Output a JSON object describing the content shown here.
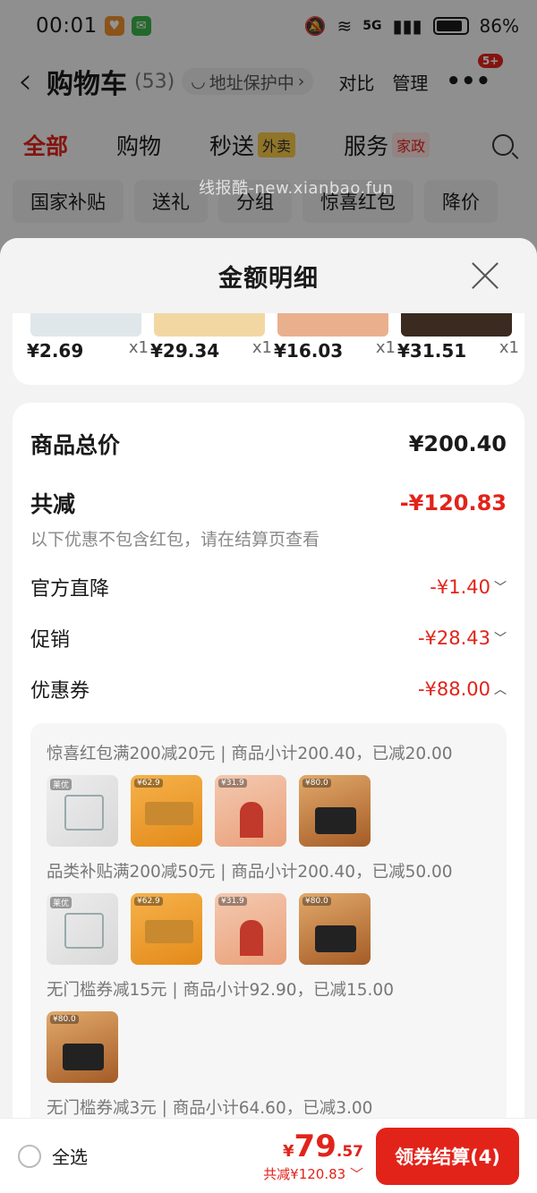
{
  "status_bar": {
    "time": "00:01",
    "network": "5G",
    "battery": "86%"
  },
  "cart_header": {
    "back_icon": "chevron-left-icon",
    "title": "购物车",
    "count": "(53)",
    "address_pill": "地址保护中",
    "compare": "对比",
    "manage": "管理",
    "more_badge": "5+"
  },
  "category_tabs": [
    {
      "label": "全部",
      "tag": ""
    },
    {
      "label": "购物",
      "tag": ""
    },
    {
      "label": "秒送",
      "tag": "外卖"
    },
    {
      "label": "服务",
      "tag": "家政"
    }
  ],
  "filter_chips": [
    "国家补贴",
    "送礼",
    "分组",
    "惊喜红包",
    "降价"
  ],
  "watermark": "线报酷-new.xianbao.fun",
  "sheet": {
    "title": "金额明细",
    "products": [
      {
        "price": "¥2.69",
        "qty": "x1",
        "color": "#dfe7ea"
      },
      {
        "price": "¥29.34",
        "qty": "x1",
        "color": "#f3d7a3"
      },
      {
        "price": "¥16.03",
        "qty": "x1",
        "color": "#e9b08e"
      },
      {
        "price": "¥31.51",
        "qty": "x1",
        "color": "#3a2a20"
      }
    ],
    "total_label": "商品总价",
    "total_value": "¥200.40",
    "reduce_label": "共减",
    "reduce_value": "-¥120.83",
    "note": "以下优惠不包含红包，请在结算页查看",
    "lines": [
      {
        "label": "官方直降",
        "value": "-¥1.40",
        "chevron": "chevron-down-icon"
      },
      {
        "label": "促销",
        "value": "-¥28.43",
        "chevron": "chevron-down-icon"
      },
      {
        "label": "优惠券",
        "value": "-¥88.00",
        "chevron": "chevron-up-icon"
      }
    ],
    "coupons": [
      {
        "text": "惊喜红包满200减20元 | 商品小计200.40，已减20.00",
        "thumbs": [
          "hooks",
          "tray",
          "chef",
          "bread"
        ]
      },
      {
        "text": "品类补贴满200减50元 | 商品小计200.40，已减50.00",
        "thumbs": [
          "hooks",
          "tray",
          "chef",
          "bread"
        ]
      },
      {
        "text": "无门槛券减15元 | 商品小计92.90，已减15.00",
        "thumbs": [
          "bread"
        ]
      },
      {
        "text": "无门槛券减3元 | 商品小计64.60，已减3.00",
        "thumbs": [
          "chef"
        ]
      }
    ]
  },
  "bottom_bar": {
    "select_all": "全选",
    "price_yen": "¥",
    "price_int": "79",
    "price_dec": ".57",
    "reduce_text": "共减¥120.83",
    "checkout": "领券结算(4)"
  },
  "colors": {
    "accent": "#e2231a"
  }
}
